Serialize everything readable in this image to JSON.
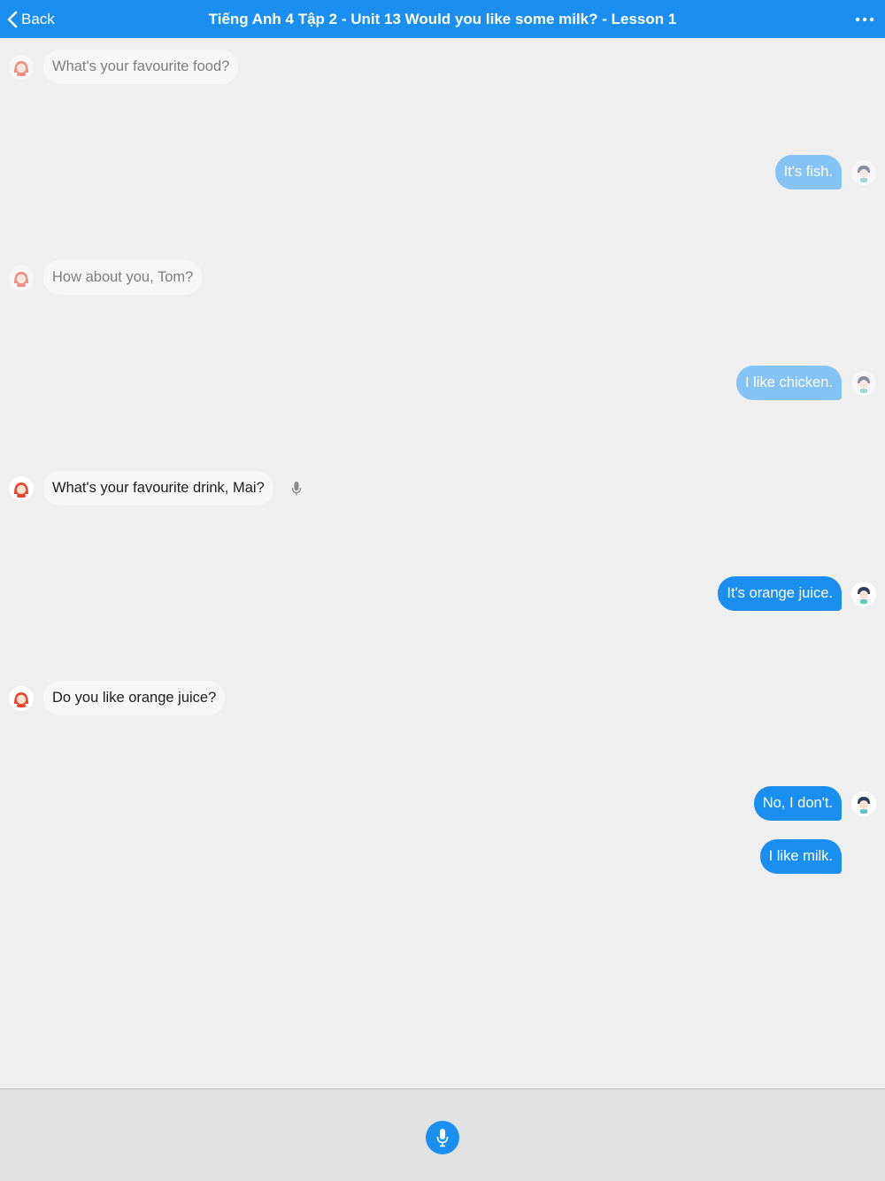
{
  "header": {
    "back_label": "Back",
    "title": "Tiếng Anh 4 Tập 2 - Unit 13 Would you like some milk? - Lesson 1",
    "accent_color": "#1a8ff0"
  },
  "messages": [
    {
      "side": "left",
      "speaker_icon": "girl-avatar-icon",
      "text": "What's your favourite food?",
      "state": "read"
    },
    {
      "side": "right",
      "speaker_icon": "boy-avatar-icon",
      "text": "It's fish.",
      "state": "read"
    },
    {
      "side": "left",
      "speaker_icon": "girl-avatar-icon",
      "text": "How about you, Tom?",
      "state": "read"
    },
    {
      "side": "right",
      "speaker_icon": "boy-avatar-icon",
      "text": "I like chicken.",
      "state": "read"
    },
    {
      "side": "left",
      "speaker_icon": "girl-avatar-icon",
      "text": "What's your favourite drink, Mai?",
      "state": "active",
      "has_mic": true
    },
    {
      "side": "right",
      "speaker_icon": "boy-avatar-icon",
      "text": "It's orange juice.",
      "state": "active"
    },
    {
      "side": "left",
      "speaker_icon": "girl-avatar-icon",
      "text": "Do you like orange juice?",
      "state": "active"
    },
    {
      "side": "right",
      "speaker_icon": "boy-avatar-icon",
      "text": "No, I don't.",
      "state": "active"
    },
    {
      "side": "right",
      "speaker_icon": "",
      "text": "I like milk.",
      "state": "active"
    }
  ],
  "footer": {
    "mic_icon": "microphone-icon"
  }
}
